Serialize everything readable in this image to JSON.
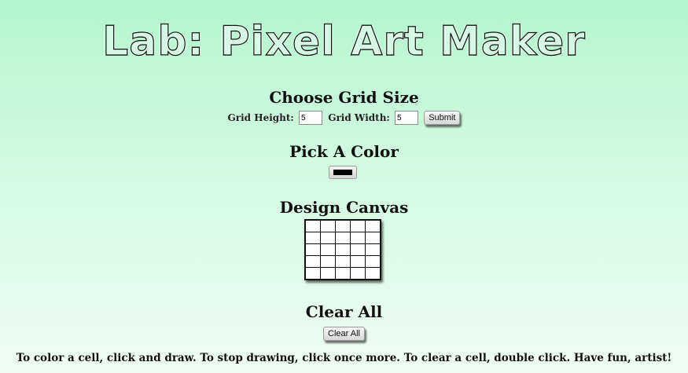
{
  "title": "Lab: Pixel Art Maker",
  "grid_section": {
    "heading": "Choose Grid Size",
    "height_label": "Grid Height:",
    "height_value": "5",
    "width_label": "Grid Width:",
    "width_value": "5",
    "submit_label": "Submit"
  },
  "color_section": {
    "heading": "Pick A Color",
    "selected_color": "#000000"
  },
  "canvas_section": {
    "heading": "Design Canvas",
    "rows": 5,
    "cols": 5,
    "cell_color": "#ffffff"
  },
  "clear_section": {
    "heading": "Clear All",
    "button_label": "Clear All"
  },
  "instructions": "To color a cell, click and draw. To stop drawing, click once more. To clear a cell, double click. Have fun, artist!"
}
